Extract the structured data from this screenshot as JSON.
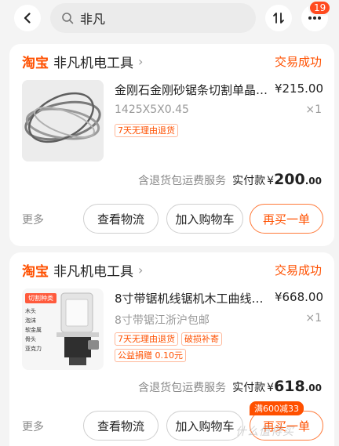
{
  "header": {
    "search_query": "非凡",
    "badge_count": "19"
  },
  "orders": [
    {
      "platform": "淘宝",
      "shop": "非凡机电工具",
      "status": "交易成功",
      "product_title": "金刚石金刚砂锯条切割单晶…",
      "price": "¥215.00",
      "spec": "1425X5X0.45",
      "quantity": "×1",
      "tags": [
        "7天无理由退货"
      ],
      "service_text": "含退货包运费服务",
      "paid_label": "实付款",
      "paid_currency": "¥",
      "paid_amount": "200",
      "paid_decimal": ".00",
      "more": "更多",
      "btn_logistics": "查看物流",
      "btn_cart": "加入购物车",
      "btn_rebuy": "再买一单"
    },
    {
      "platform": "淘宝",
      "shop": "非凡机电工具",
      "status": "交易成功",
      "product_title": "8寸带锯机线锯机木工曲线…",
      "price": "¥668.00",
      "spec": "8寸带锯江浙沪包邮",
      "quantity": "×1",
      "tags": [
        "7天无理由退货",
        "破损补寄",
        "公益捐赠 0.10元"
      ],
      "service_text": "含退货包运费服务",
      "paid_label": "实付款",
      "paid_currency": "¥",
      "paid_amount": "618",
      "paid_decimal": ".00",
      "more": "更多",
      "btn_logistics": "查看物流",
      "btn_cart": "加入购物车",
      "btn_rebuy": "再买一单",
      "promo": "满600减33",
      "thumb_caption": "切割种类",
      "thumb_list": [
        "木头",
        "泡沫",
        "软金属",
        "骨头",
        "亚克力"
      ]
    }
  ],
  "watermark": "什么值得买",
  "colors": {
    "accent": "#ff5000",
    "badge": "#ff4a1f",
    "page_bg": "#f4f4f4"
  }
}
